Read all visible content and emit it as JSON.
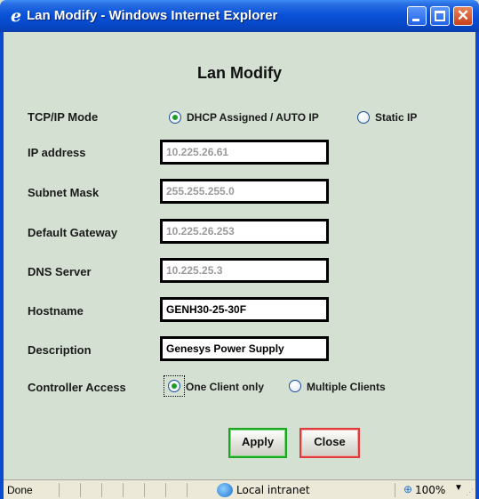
{
  "window": {
    "title": "Lan Modify - Windows Internet Explorer",
    "icon": "ie-icon"
  },
  "page": {
    "title": "Lan Modify"
  },
  "form": {
    "tcpip_mode": {
      "label": "TCP/IP Mode",
      "options": [
        "DHCP Assigned  / AUTO IP",
        "Static IP"
      ],
      "selected": "DHCP Assigned  / AUTO IP"
    },
    "ip_address": {
      "label": "IP address",
      "value": "10.225.26.61"
    },
    "subnet_mask": {
      "label": "Subnet Mask",
      "value": "255.255.255.0"
    },
    "default_gateway": {
      "label": "Default Gateway",
      "value": "10.225.26.253"
    },
    "dns_server": {
      "label": "DNS Server",
      "value": "10.225.25.3"
    },
    "hostname": {
      "label": "Hostname",
      "value": "GENH30-25-30F"
    },
    "description": {
      "label": "Description",
      "value": "Genesys Power Supply"
    },
    "controller_access": {
      "label": "Controller Access",
      "options": [
        "One Client only",
        "Multiple Clients"
      ],
      "selected": "One Client only"
    }
  },
  "buttons": {
    "apply": "Apply",
    "close": "Close"
  },
  "statusbar": {
    "status": "Done",
    "zone": "Local intranet",
    "zoom": "100%"
  },
  "colors": {
    "titlebar": "#0a52d9",
    "background": "#d4e1d2",
    "apply_border": "#19a81e",
    "close_border": "#e03a3a"
  }
}
